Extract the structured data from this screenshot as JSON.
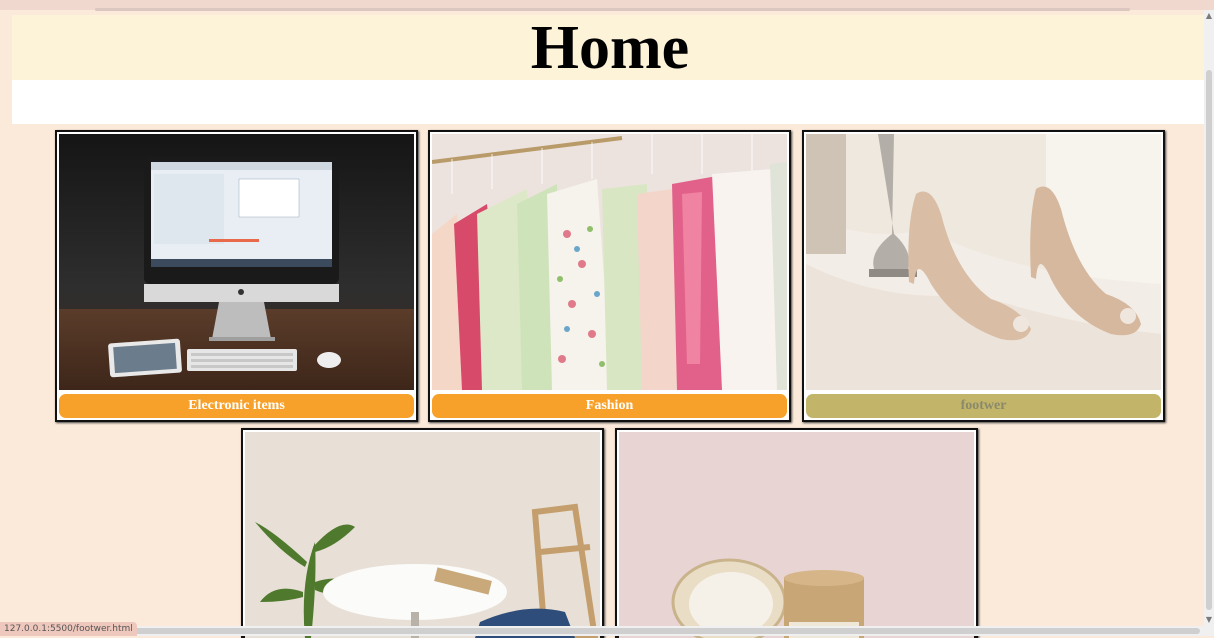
{
  "page": {
    "title": "Home"
  },
  "cards": [
    {
      "label": "Electronic items",
      "label_bg": "#f7a12a",
      "label_color": "#ffffff"
    },
    {
      "label": "Fashion",
      "label_bg": "#f7a12a",
      "label_color": "#ffffff"
    },
    {
      "label": "footwer",
      "label_bg": "#c2b469",
      "label_color": "#8a8a6a"
    }
  ],
  "status_bar": {
    "url": "127.0.0.1:5500/footwer.html"
  }
}
